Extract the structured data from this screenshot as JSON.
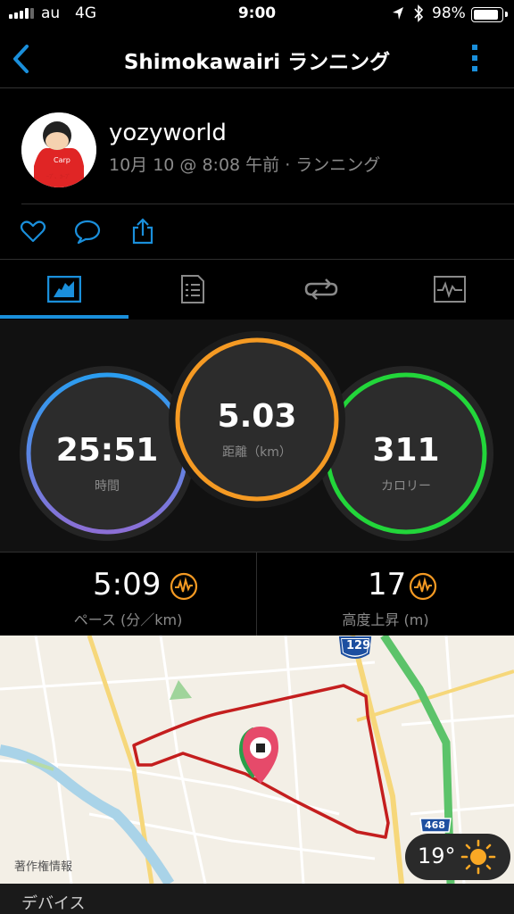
{
  "status_bar": {
    "carrier": "au",
    "network": "4G",
    "time": "9:00",
    "battery": "98%",
    "battery_level": 0.98
  },
  "nav": {
    "title": "Shimokawairi ランニング",
    "back_icon": "chevron-left-icon",
    "more_icon": "more-vertical-icon"
  },
  "activity": {
    "username": "yozyworld",
    "meta": "10月 10 @ 8:08 午前 · ランニング"
  },
  "actions": [
    "heart-icon",
    "comment-icon",
    "share-icon"
  ],
  "tabs": [
    {
      "icon": "overview-icon",
      "active": true
    },
    {
      "icon": "details-icon",
      "active": false
    },
    {
      "icon": "laps-icon",
      "active": false
    },
    {
      "icon": "chart-icon",
      "active": false
    }
  ],
  "stats": {
    "time": {
      "value": "25:51",
      "label": "時間"
    },
    "distance": {
      "value": "5.03",
      "label": "距離（km）"
    },
    "calories": {
      "value": "311",
      "label": "カロリー"
    },
    "pace": {
      "value": "5:09",
      "label": "ペース (分／km)"
    },
    "elevation": {
      "value": "17",
      "label": "高度上昇 (m)"
    }
  },
  "colors": {
    "accent": "#1a8fdb",
    "time_ring": "#7f6fd6",
    "distance_ring": "#f59a23",
    "calories_ring": "#22d63a",
    "route": "#c41e1e"
  },
  "map": {
    "credit": "著作権情報",
    "road_labels": [
      "129",
      "468"
    ],
    "weather_temp": "19°",
    "weather_icon": "sun-icon"
  },
  "footer": {
    "section_label": "デバイス"
  }
}
